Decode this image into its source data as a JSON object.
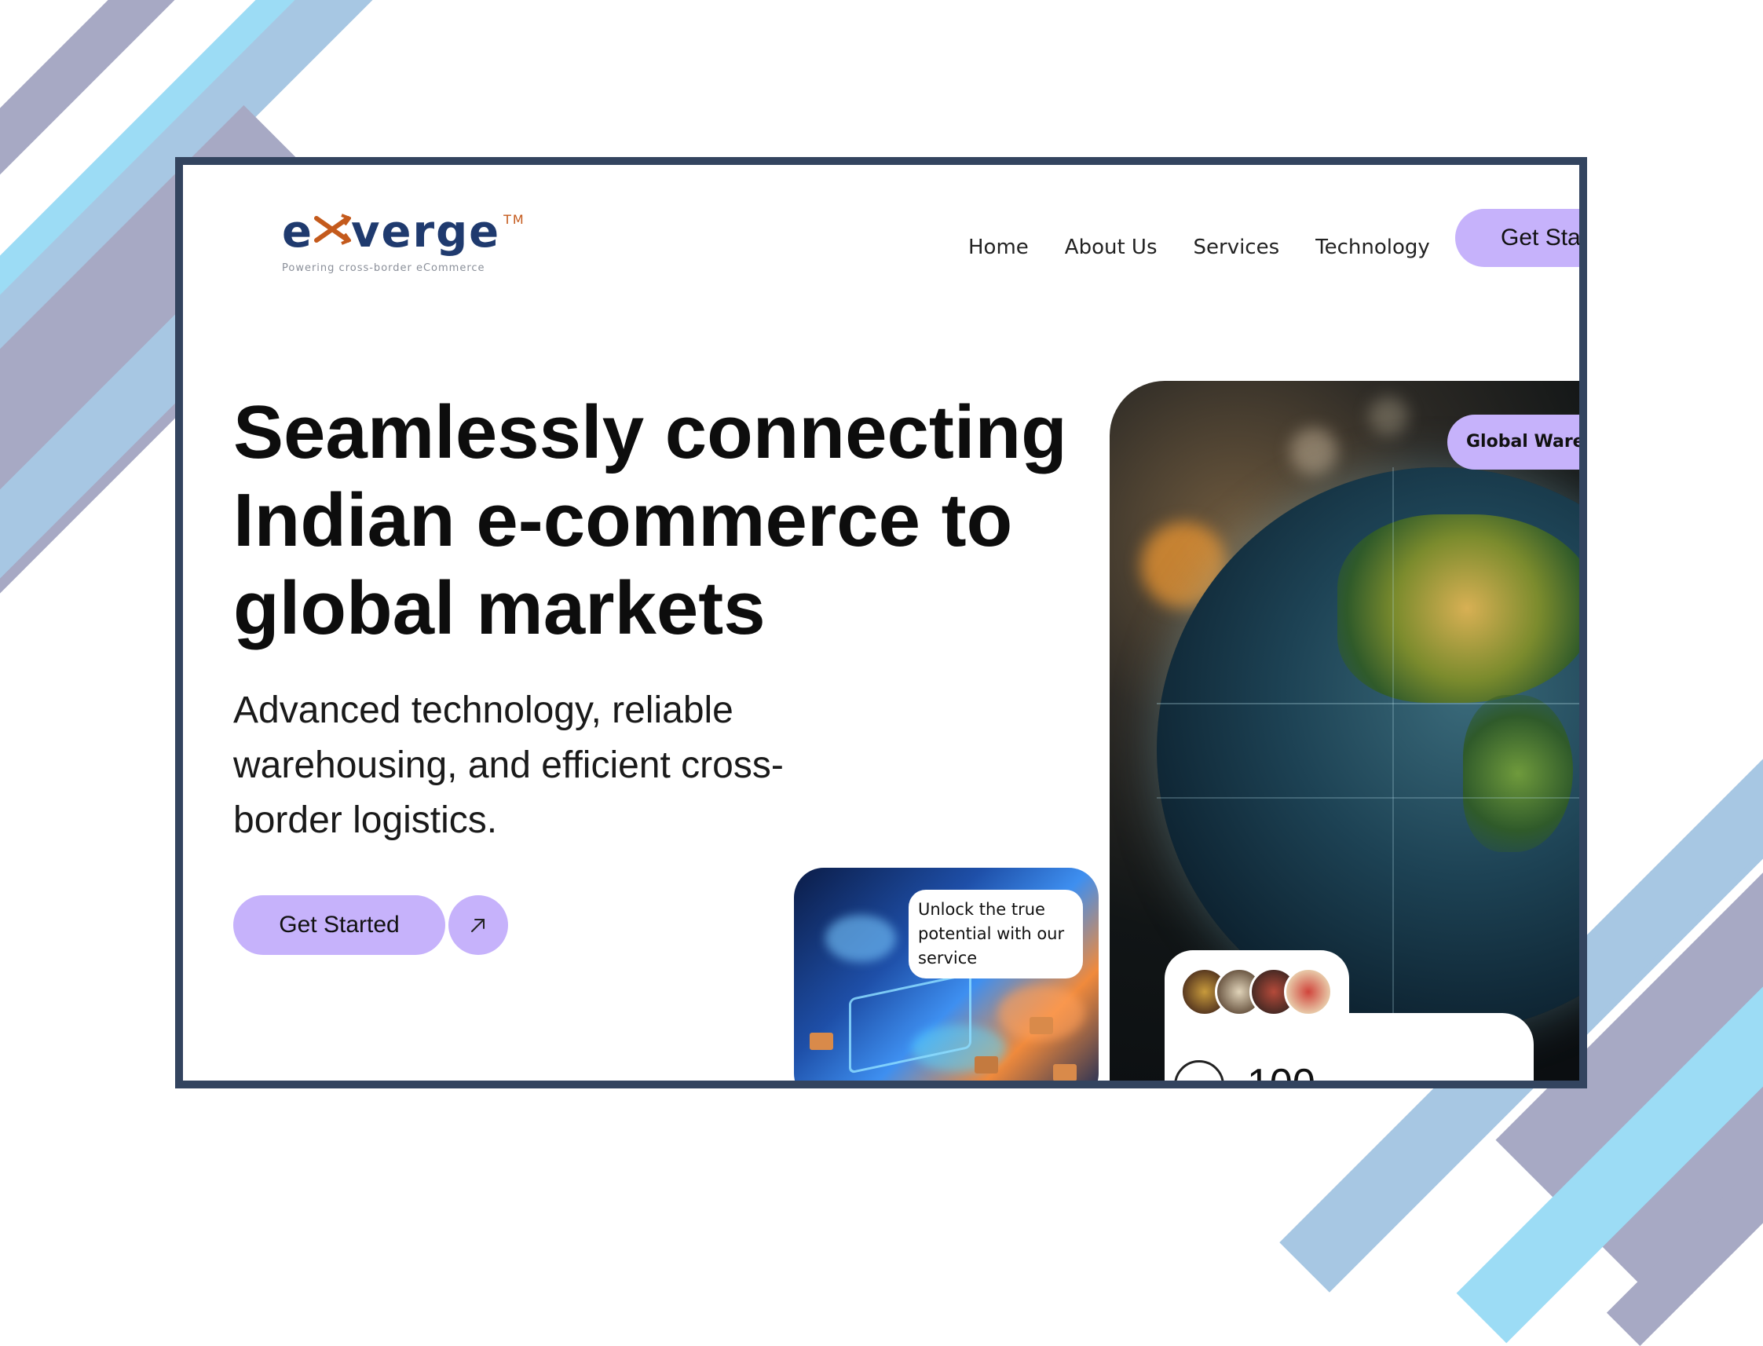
{
  "brand": {
    "name_left": "e",
    "name_right": "verge",
    "trademark": "TM",
    "tagline": "Powering cross-border eCommerce"
  },
  "nav": {
    "items": [
      "Home",
      "About Us",
      "Services",
      "Technology"
    ],
    "cta_label": "Get Sta"
  },
  "hero": {
    "title": "Seamlessly connecting Indian e-commerce to global markets",
    "subtitle": "Advanced technology, reliable warehousing, and efficient cross-border logistics.",
    "cta_label": "Get Started"
  },
  "cards": {
    "service_bubble": "Unlock the true potential with our service",
    "globe_tag": "Global Wareh",
    "stat_partial": "100"
  },
  "colors": {
    "accent": "#c6b2fb",
    "frame": "#33445f",
    "stripe_light_blue": "#9cdcf5",
    "stripe_steel_blue": "#a7c7e3",
    "stripe_lavender_gray": "#a7a9c4"
  },
  "icons": {
    "cta_arrow": "arrow-up-right-icon"
  }
}
